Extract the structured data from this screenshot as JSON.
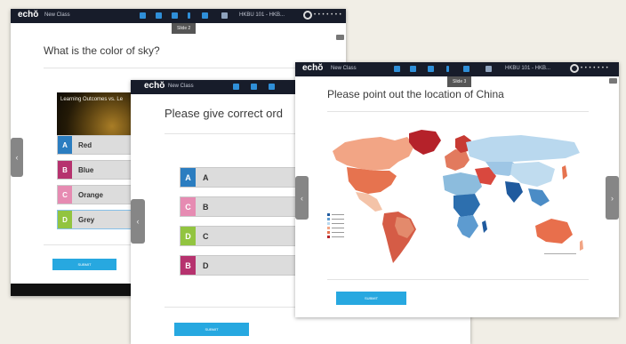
{
  "colors": {
    "topbar": "#171c2a",
    "accent": "#27a8e0",
    "nav": "#868686"
  },
  "windows": {
    "sky": {
      "logo": "echŏ",
      "class_label": "New Class",
      "course": "HKBU 101 - HKB...",
      "user_icon": "user-icon",
      "user_dots": "• • • • • • •",
      "slide": "Slide 2",
      "question": "What is the color of sky?",
      "outcomes_label": "Learning Outcomes vs. Le",
      "options": [
        {
          "letter": "A",
          "text": "Red",
          "color": "#2b7dc0"
        },
        {
          "letter": "B",
          "text": "Blue",
          "color": "#b6326e"
        },
        {
          "letter": "C",
          "text": "Orange",
          "color": "#e68bb2"
        },
        {
          "letter": "D",
          "text": "Grey",
          "color": "#92c440"
        }
      ],
      "submit": "SUBMIT",
      "prev": "‹"
    },
    "order": {
      "logo": "echŏ",
      "class_label": "New Class",
      "question": "Please give correct ord",
      "options": [
        {
          "letter": "A",
          "text": "A",
          "color": "#2b7dc0"
        },
        {
          "letter": "C",
          "text": "B",
          "color": "#e68bb2"
        },
        {
          "letter": "D",
          "text": "C",
          "color": "#92c440"
        },
        {
          "letter": "B",
          "text": "D",
          "color": "#b6326e"
        }
      ],
      "submit": "SUBMIT",
      "prev": "‹"
    },
    "china": {
      "logo": "echŏ",
      "class_label": "New Class",
      "course": "HKBU 101 - HKB...",
      "user_icon": "user-icon",
      "user_dots": "• • • • • • •",
      "slide": "Slide 3",
      "question": "Please point out the location of China",
      "map": "world-map",
      "submit": "SUBMIT",
      "prev": "‹",
      "next": "›"
    }
  }
}
